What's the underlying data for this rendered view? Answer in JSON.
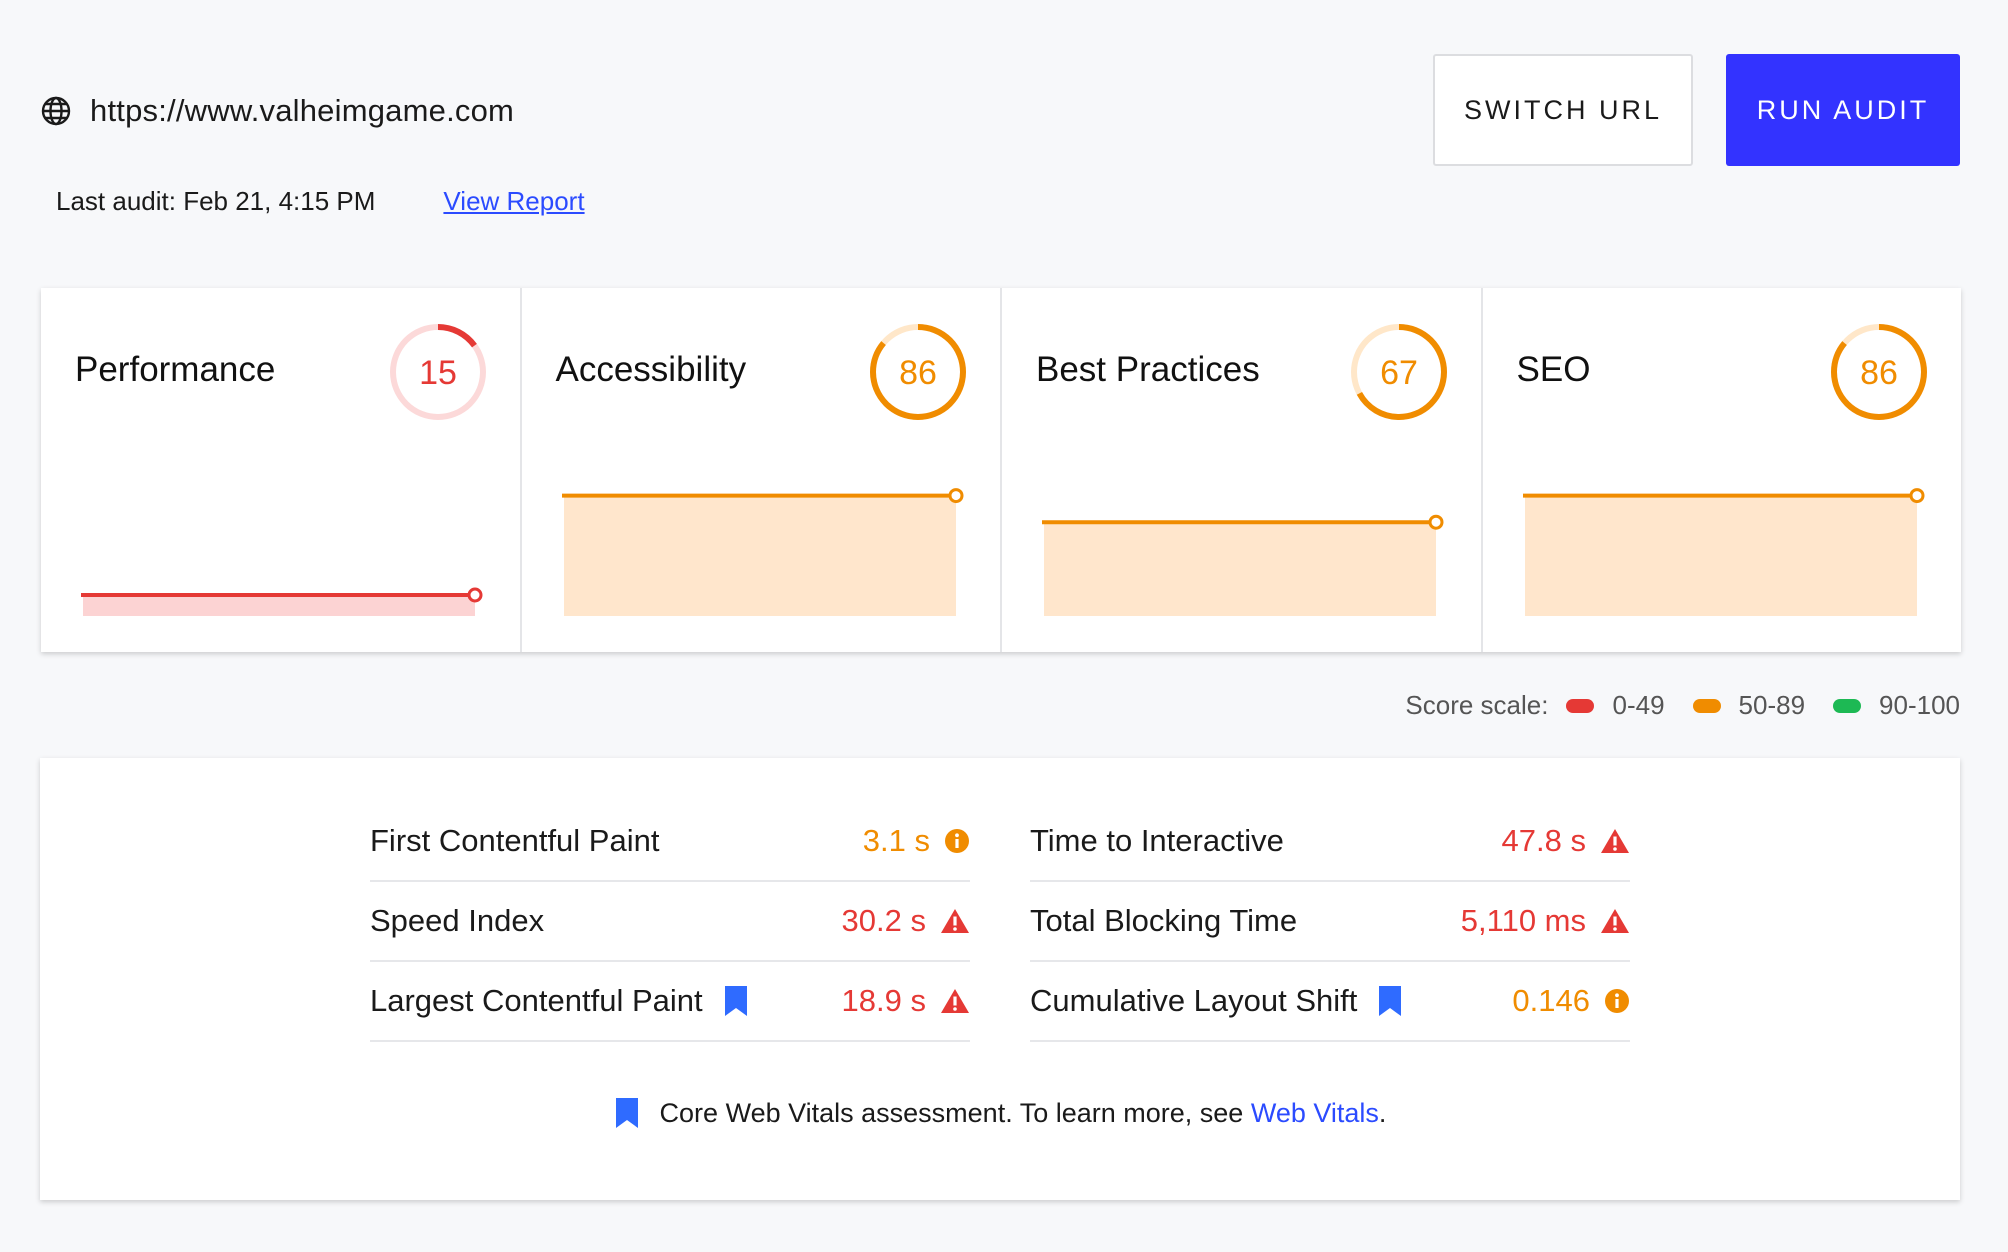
{
  "header": {
    "url": "https://www.valheimgame.com",
    "last_audit": "Last audit: Feb 21, 4:15 PM",
    "view_report": "View Report",
    "switch_url": "SWITCH URL",
    "run_audit": "RUN AUDIT"
  },
  "colors": {
    "red": "#e53935",
    "orange": "#f08c00",
    "green": "#1db954",
    "accent": "#3333ff"
  },
  "cards": [
    {
      "title": "Performance",
      "score": "15",
      "color": "red",
      "fraction": 0.15
    },
    {
      "title": "Accessibility",
      "score": "86",
      "color": "orange",
      "fraction": 0.86
    },
    {
      "title": "Best Practices",
      "score": "67",
      "color": "orange",
      "fraction": 0.67
    },
    {
      "title": "SEO",
      "score": "86",
      "color": "orange",
      "fraction": 0.86
    }
  ],
  "scale": {
    "label": "Score scale:",
    "ranges": [
      "0-49",
      "50-89",
      "90-100"
    ]
  },
  "metrics": {
    "left": [
      {
        "name": "First Contentful Paint",
        "value": "3.1 s",
        "status": "orange",
        "icon": "info-icon",
        "bookmark": false
      },
      {
        "name": "Speed Index",
        "value": "30.2 s",
        "status": "red",
        "icon": "warning-icon",
        "bookmark": false
      },
      {
        "name": "Largest Contentful Paint",
        "value": "18.9 s",
        "status": "red",
        "icon": "warning-icon",
        "bookmark": true
      }
    ],
    "right": [
      {
        "name": "Time to Interactive",
        "value": "47.8 s",
        "status": "red",
        "icon": "warning-icon",
        "bookmark": false
      },
      {
        "name": "Total Blocking Time",
        "value": "5,110 ms",
        "status": "red",
        "icon": "warning-icon",
        "bookmark": false
      },
      {
        "name": "Cumulative Layout Shift",
        "value": "0.146",
        "status": "orange",
        "icon": "info-icon",
        "bookmark": true
      }
    ]
  },
  "footer": {
    "text": "Core Web Vitals assessment. To learn more, see",
    "link": "Web Vitals",
    "period": "."
  }
}
